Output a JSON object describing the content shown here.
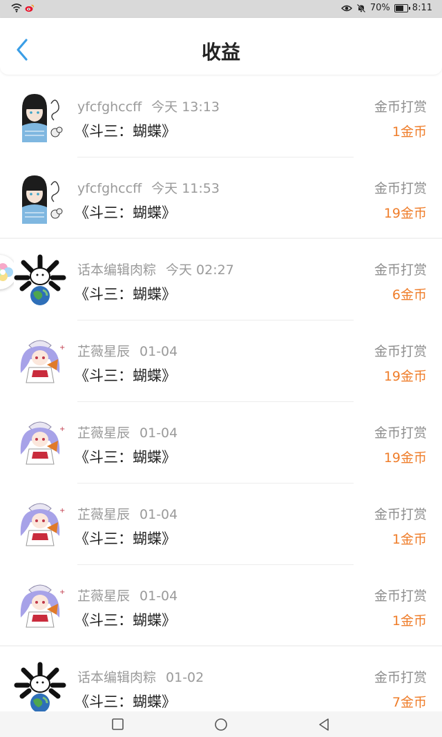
{
  "status_bar": {
    "battery": "70%",
    "time": "8:11"
  },
  "header": {
    "title": "收益"
  },
  "colors": {
    "accent": "#3a9ee6",
    "amount": "#ef7d2a"
  },
  "items": [
    {
      "user": "yfcfghccff",
      "time": "今天 13:13",
      "title": "《斗三：蝴蝶》",
      "type": "金币打赏",
      "amount": "1金币"
    },
    {
      "user": "yfcfghccff",
      "time": "今天 11:53",
      "title": "《斗三：蝴蝶》",
      "type": "金币打赏",
      "amount": "19金币"
    },
    {
      "user": "话本编辑肉粽",
      "time": "今天 02:27",
      "title": "《斗三：蝴蝶》",
      "type": "金币打赏",
      "amount": "6金币"
    },
    {
      "user": "芷薇星辰",
      "time": "01-04",
      "title": "《斗三：蝴蝶》",
      "type": "金币打赏",
      "amount": "19金币"
    },
    {
      "user": "芷薇星辰",
      "time": "01-04",
      "title": "《斗三：蝴蝶》",
      "type": "金币打赏",
      "amount": "19金币"
    },
    {
      "user": "芷薇星辰",
      "time": "01-04",
      "title": "《斗三：蝴蝶》",
      "type": "金币打赏",
      "amount": "1金币"
    },
    {
      "user": "芷薇星辰",
      "time": "01-04",
      "title": "《斗三：蝴蝶》",
      "type": "金币打赏",
      "amount": "1金币"
    },
    {
      "user": "话本编辑肉粽",
      "time": "01-02",
      "title": "《斗三：蝴蝶》",
      "type": "金币打赏",
      "amount": "7金币"
    }
  ]
}
